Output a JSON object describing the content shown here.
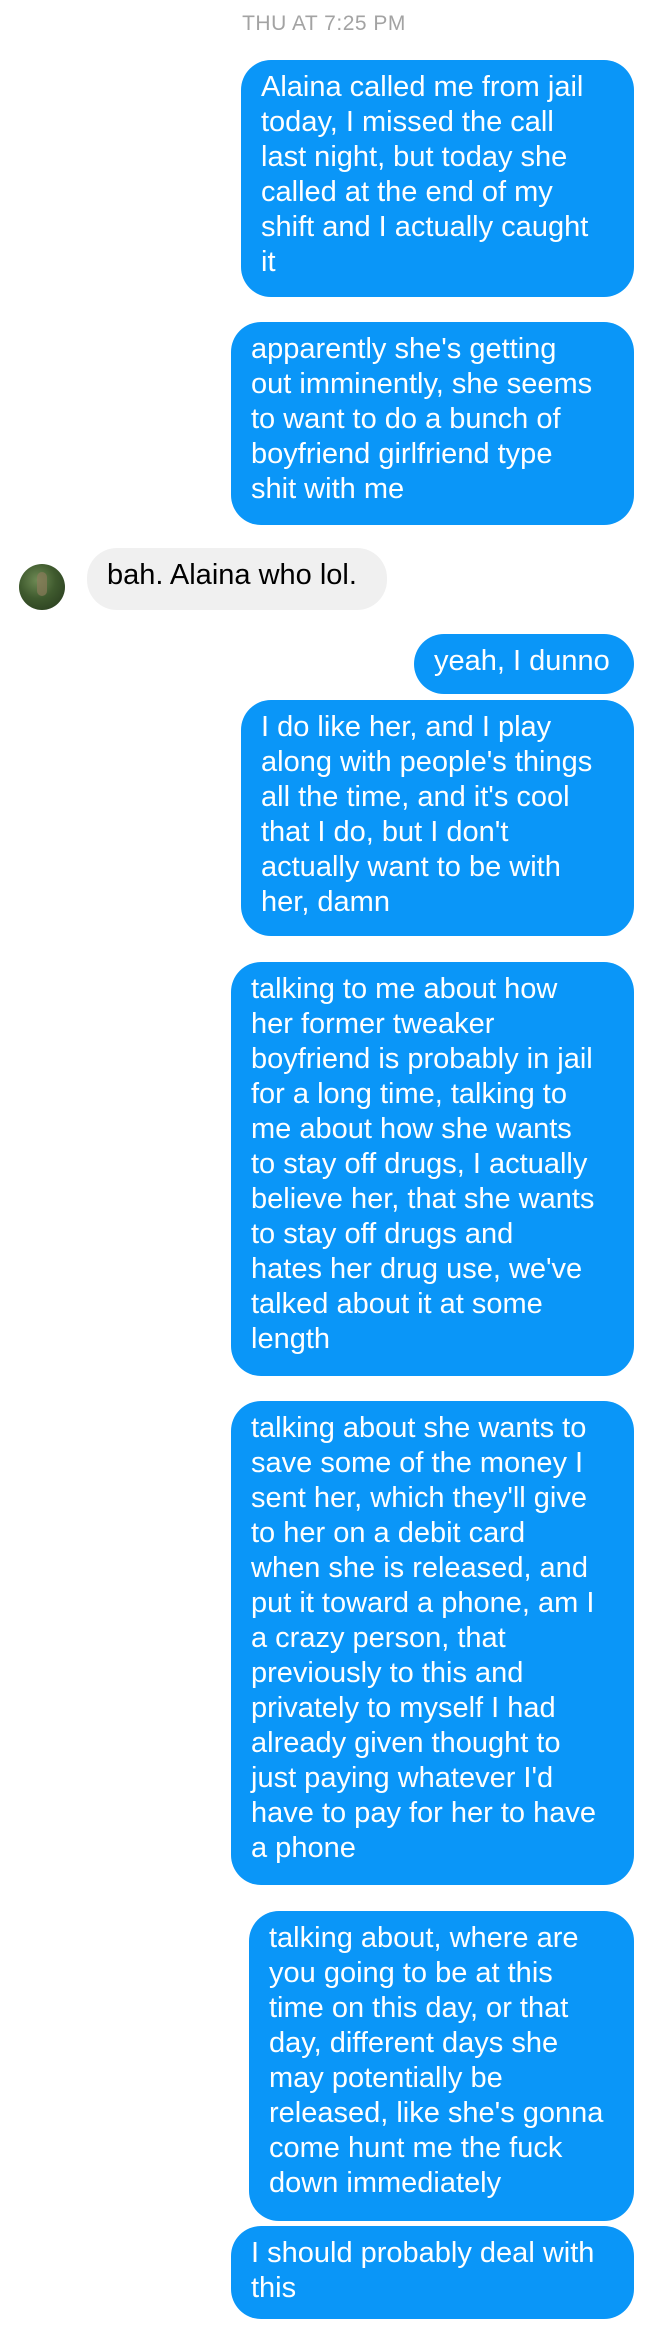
{
  "header": {
    "timestamp": "THU AT 7:25 PM"
  },
  "contact": {
    "avatar_icon": "contact-avatar-icon"
  },
  "colors": {
    "outgoing_bubble": "#0a96f8",
    "incoming_bubble": "#f0f0f0",
    "timestamp_text": "#a3a3a3"
  },
  "messages": [
    {
      "sender": "me",
      "text": "Alaina called me from jail\ntoday, I missed the call\nlast night, but today she\ncalled at the end of my\nshift and I actually caught\nit"
    },
    {
      "sender": "me",
      "text": "apparently she's getting\nout imminently, she seems\nto want to do a bunch of\nboyfriend girlfriend type\nshit with me"
    },
    {
      "sender": "them",
      "text": "bah. Alaina who lol."
    },
    {
      "sender": "me",
      "text": "yeah, I dunno"
    },
    {
      "sender": "me",
      "text": "I do like her, and I play\nalong with people's things\nall the time, and it's cool\nthat I do, but I don't\nactually want to be with\nher, damn"
    },
    {
      "sender": "me",
      "text": "talking to me about how\nher former tweaker\nboyfriend is probably in jail\nfor a long time, talking to\nme about how she wants\nto stay off drugs, I actually\nbelieve her, that she wants\nto stay off drugs and\nhates her drug use, we've\ntalked about it at some\nlength"
    },
    {
      "sender": "me",
      "text": "talking about she wants to\nsave some of the money I\nsent her, which they'll give\nto her on a debit card\nwhen she is released, and\nput it toward a phone, am I\na crazy person, that\npreviously to this and\nprivately to myself I had\nalready given thought to\njust paying whatever I'd\nhave to pay for her to have\na phone"
    },
    {
      "sender": "me",
      "text": "talking about, where are\nyou going to be at this\ntime on this day, or that\nday, different days she\nmay potentially be\nreleased, like she's gonna\ncome hunt me the fuck\ndown immediately"
    },
    {
      "sender": "me",
      "text": "I should probably deal with\nthis"
    }
  ]
}
